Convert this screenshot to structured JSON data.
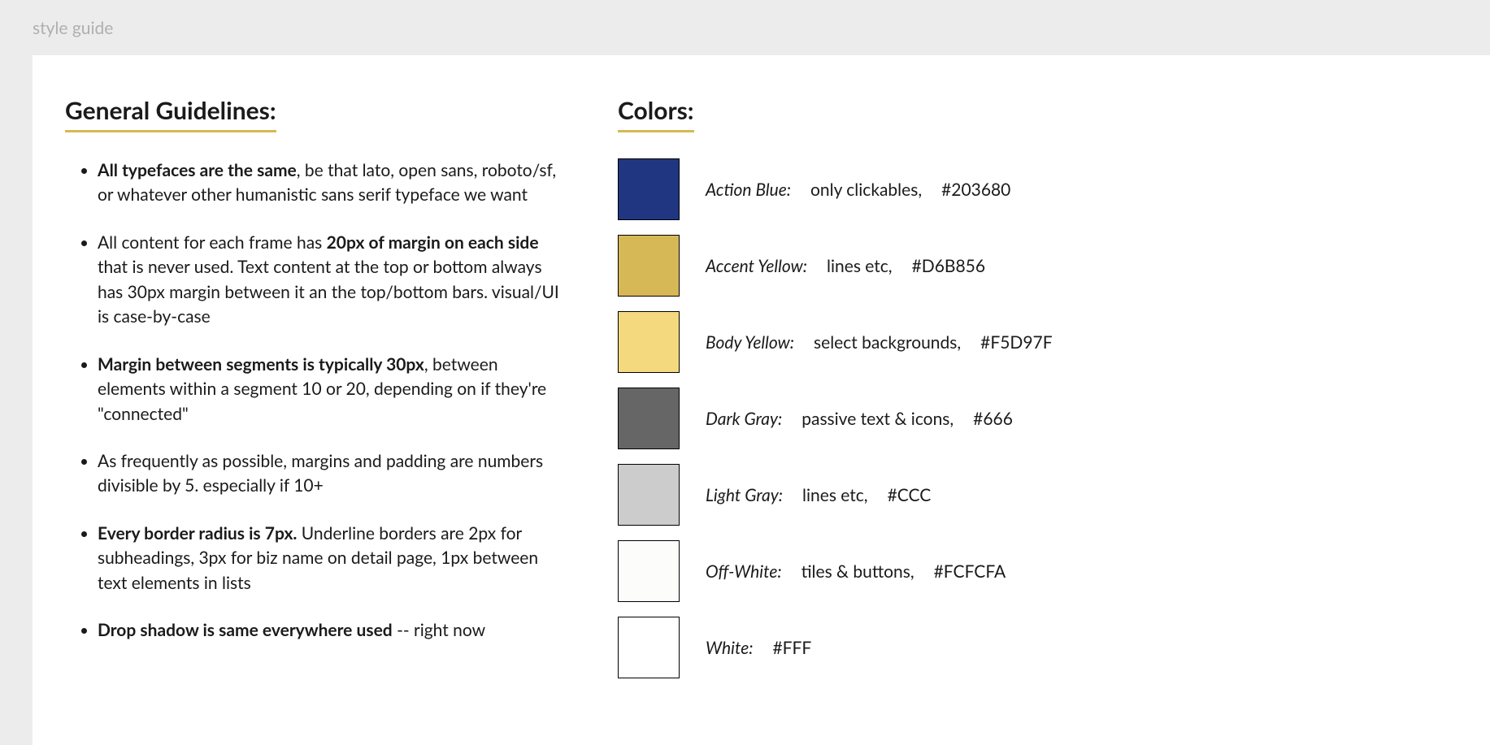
{
  "topbar": {
    "title": "style guide"
  },
  "headings": {
    "guidelines": "General Guidelines:",
    "colors": "Colors:"
  },
  "guidelines": [
    {
      "bold": "All typefaces are the same",
      "rest": ", be that lato, open sans, roboto/sf, or whatever other humanistic sans serif typeface we want"
    },
    {
      "pre": "All content for each frame has ",
      "bold": "20px of margin on each side",
      "rest": " that is never used. Text content at the top or bottom always has 30px margin between it an the top/bottom bars. visual/UI is case-by-case"
    },
    {
      "bold": "Margin between segments is typically 30px",
      "rest": ", between elements within a segment 10 or 20, depending on if they're \"connected\""
    },
    {
      "pre": "As frequently as possible, margins and padding are numbers divisible by 5. especially if 10+",
      "bold": "",
      "rest": ""
    },
    {
      "bold": "Every border radius is 7px.",
      "rest": " Underline borders are 2px for subheadings, 3px for biz name on detail page, 1px between text elements in lists"
    },
    {
      "bold": "Drop shadow is same everywhere used",
      "rest": " -- right now"
    }
  ],
  "colors": [
    {
      "name": "Action Blue:",
      "usage": "only clickables,",
      "hex": "#203680"
    },
    {
      "name": "Accent Yellow:",
      "usage": "lines etc,",
      "hex": "#D6B856"
    },
    {
      "name": "Body Yellow:",
      "usage": "select backgrounds,",
      "hex": "#F5D97F"
    },
    {
      "name": "Dark Gray:",
      "usage": "passive text & icons,",
      "hex": "#666"
    },
    {
      "name": "Light Gray:",
      "usage": "lines etc,",
      "hex": "#CCC"
    },
    {
      "name": "Off-White:",
      "usage": "tiles & buttons,",
      "hex": "#FCFCFA"
    },
    {
      "name": "White:",
      "usage": "",
      "hex": "#FFF"
    }
  ]
}
